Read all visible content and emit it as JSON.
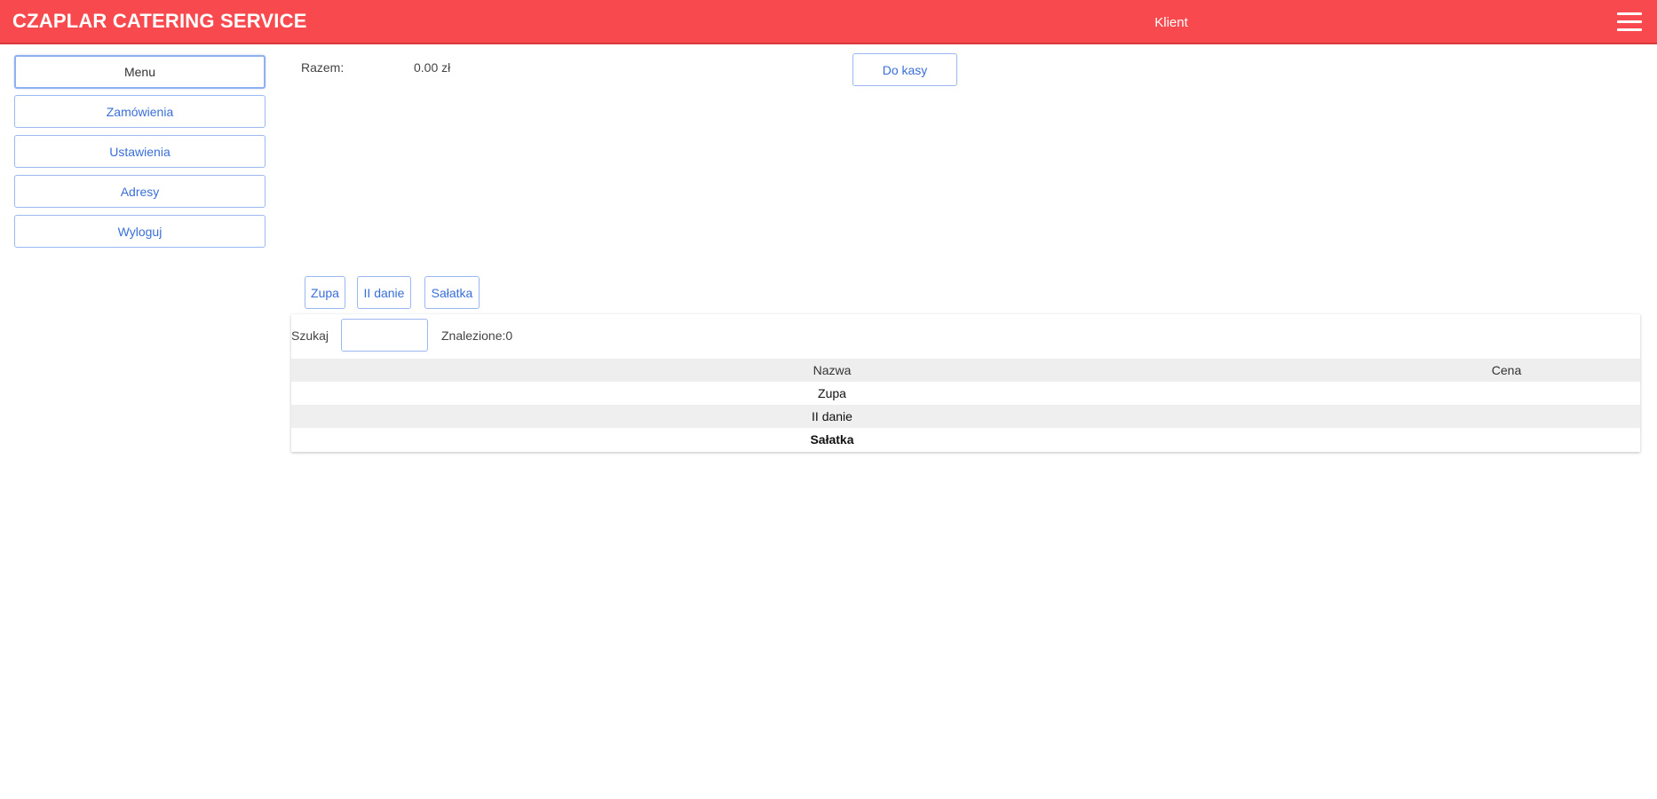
{
  "header": {
    "brand": "CZAPLAR CATERING SERVICE",
    "user_role": "Klient",
    "menu_icon": "hamburger-menu-icon"
  },
  "sidebar": {
    "items": [
      {
        "label": "Menu",
        "active": true
      },
      {
        "label": "Zamówienia",
        "active": false
      },
      {
        "label": "Ustawienia",
        "active": false
      },
      {
        "label": "Adresy",
        "active": false
      },
      {
        "label": "Wyloguj",
        "active": false
      }
    ]
  },
  "cart": {
    "total_label": "Razem:",
    "total_value": "0.00 zł",
    "checkout_label": "Do kasy"
  },
  "categories": [
    "Zupa",
    "II danie",
    "Sałatka"
  ],
  "search": {
    "label": "Szukaj",
    "value": "",
    "found_label": "Znalezione:0"
  },
  "table": {
    "headers": [
      "Nazwa",
      "Cena"
    ],
    "rows": [
      {
        "name": "Zupa",
        "price": ""
      },
      {
        "name": "II danie",
        "price": ""
      },
      {
        "name": "Sałatka",
        "price": ""
      }
    ]
  },
  "colors": {
    "header_bg": "#f84a4e",
    "accent_blue": "#3a6fd8",
    "border_blue": "#9bb8f2"
  }
}
